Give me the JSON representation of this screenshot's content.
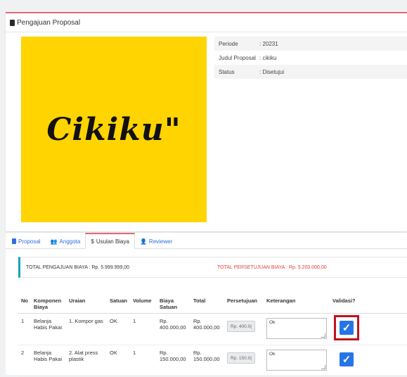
{
  "header": {
    "title": "Pengajuan Proposal",
    "icon": "document-icon"
  },
  "logo": {
    "text": "Cikiku\"",
    "background": "#ffd400"
  },
  "info": [
    {
      "label": "Periode",
      "value": ": 20231"
    },
    {
      "label": "Judul Proposal",
      "value": ": cikiku"
    },
    {
      "label": "Status",
      "value": ": Disetujui"
    }
  ],
  "tabs": [
    {
      "label": "Proposal",
      "icon": "document-icon"
    },
    {
      "label": "Anggota",
      "icon": "users-icon"
    },
    {
      "label": "Usulan Biaya",
      "icon": "dollar-icon"
    },
    {
      "label": "Reviewer",
      "icon": "user-edit-icon"
    }
  ],
  "summary": {
    "total_pengajuan": "TOTAL PENGAJUAN BIAYA : Rp. 5.999.999,00",
    "total_persetujuan": "TOTAL PERSETUJUAN BIAYA : Rp. 5.200.000,00"
  },
  "table": {
    "headers": [
      "No",
      "Komponen Biaya",
      "Uraian",
      "Satuan",
      "Volume",
      "Biaya Satuan",
      "Total",
      "Persetujuan",
      "Keterangan",
      "Validasi?"
    ],
    "rows": [
      {
        "no": "1",
        "komponen": "Belanja Habis Pakai",
        "uraian": "1. Kompor gas",
        "satuan": "OK",
        "volume": "1",
        "biaya": "Rp. 400.000,00",
        "total": "Rp. 400.000,00",
        "persetujuan": "Rp. 400.0(",
        "keterangan": "Ok",
        "validasi": true
      },
      {
        "no": "2",
        "komponen": "Belanja Habis Pakai",
        "uraian": "2. Alat press plastik",
        "satuan": "OK",
        "volume": "1",
        "biaya": "Rp. 150.000,00",
        "total": "Rp. 150.000,00",
        "persetujuan": "Rp. 150.0(",
        "keterangan": "Ok",
        "validasi": true
      }
    ]
  },
  "colors": {
    "accent": "#e06a73",
    "link": "#2f6fde",
    "checkbox": "#2575e8",
    "highlight": "#c0121c"
  }
}
